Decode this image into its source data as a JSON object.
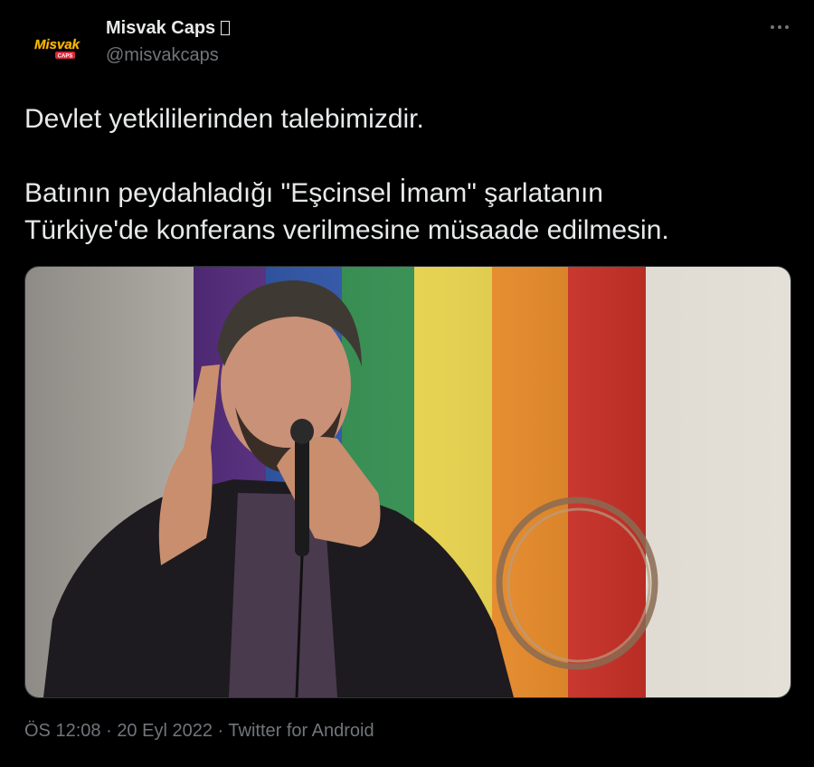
{
  "author": {
    "display_name": "Misvak Caps",
    "handle": "@misvakcaps",
    "avatar_text": "Misvak",
    "avatar_subtext": "CAPS"
  },
  "tweet": {
    "line1": "Devlet yetkililerinden talebimizdir.",
    "line2": "Batının peydahladığı \"Eşcinsel İmam\" şarlatanın",
    "line3": "Türkiye'de konferans verilmesine müsaade edilmesin."
  },
  "meta": {
    "time": "ÖS 12:08",
    "date": "20 Eyl 2022",
    "source": "Twitter for Android",
    "separator": "·"
  },
  "icons": {
    "more": "more-horizontal-icon"
  },
  "colors": {
    "background": "#000000",
    "text": "#e7e9ea",
    "secondary": "#71767b",
    "avatar_yellow": "#f6c700"
  }
}
